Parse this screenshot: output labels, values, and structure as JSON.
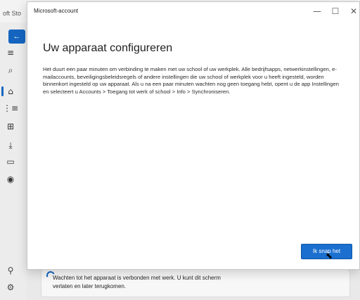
{
  "background": {
    "app_title": "oft Sto"
  },
  "sidebar": {
    "back_glyph": "←",
    "items": [
      {
        "name": "menu-icon",
        "glyph": "≡"
      },
      {
        "name": "search-icon",
        "glyph": "⌕"
      },
      {
        "name": "home-icon",
        "glyph": "⌂"
      },
      {
        "name": "apps-icon",
        "glyph": "⋮≡"
      },
      {
        "name": "grid-icon",
        "glyph": "⊞"
      },
      {
        "name": "download-icon",
        "glyph": "⤓"
      },
      {
        "name": "library-icon",
        "glyph": "▭"
      },
      {
        "name": "games-icon",
        "glyph": "◉"
      }
    ],
    "bottom": [
      {
        "name": "user-icon",
        "glyph": "⚲"
      },
      {
        "name": "settings-icon",
        "glyph": "⚙"
      }
    ]
  },
  "dialog": {
    "title": "Microsoft-account",
    "controls": {
      "minimize": "—",
      "maximize": "☐",
      "close": "✕"
    },
    "heading": "Uw apparaat configureren",
    "body": "Het duurt een paar minuten om verbinding te maken met uw school of uw werkplek. Alle bedrijfsapps, netwerkinstellingen, e-mailaccounts, beveiligingsbeleidsregels of andere instellingen die uw school of werkplek voor u heeft ingesteld, worden binnenkort ingesteld op uw apparaat. Als u na een paar minuten wachten nog geen toegang hebt, opent u de app Instellingen en selecteert u Accounts > Toegang tot werk of school > Info > Synchroniseren.",
    "ok_button": "Ik snap het"
  },
  "status": {
    "text": "Wachten tot het apparaat is verbonden met werk. U kunt dit scherm verlaten en later terugkomen."
  },
  "colors": {
    "accent": "#1a6fcf"
  }
}
